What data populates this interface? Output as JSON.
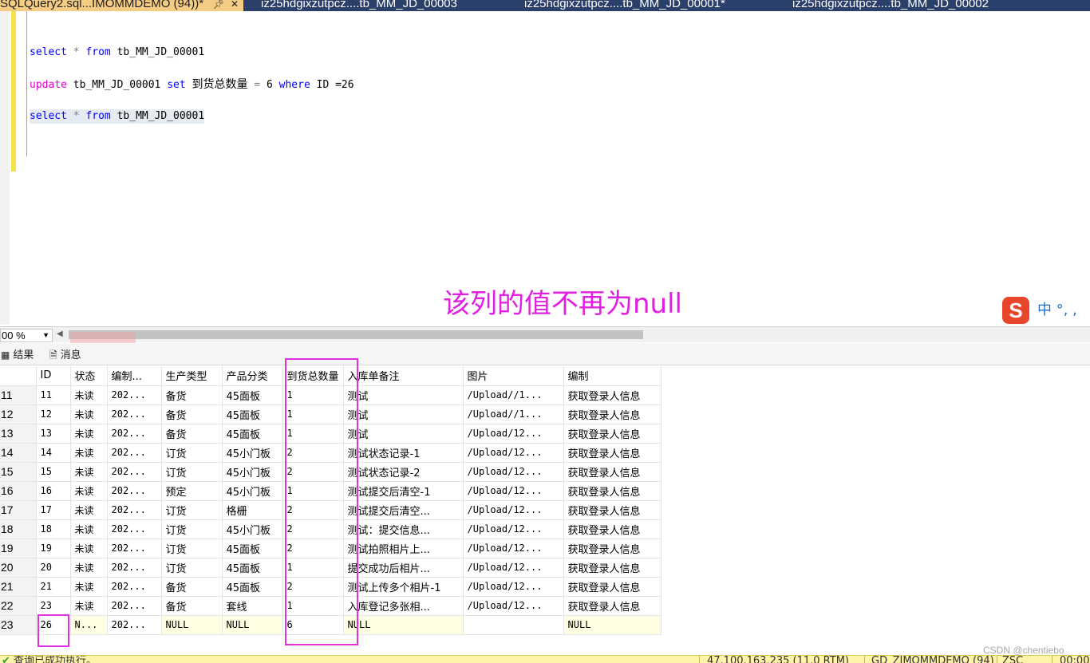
{
  "tabs": [
    {
      "label": "SQLQuery2.sql...IMOMMDEMO (94))*",
      "active": true
    },
    {
      "label": "iz25hdgixzutpcz....tb_MM_JD_00003",
      "active": false
    },
    {
      "label": "iz25hdgixzutpcz....tb_MM_JD_00001*",
      "active": false
    },
    {
      "label": "iz25hdgixzutpcz....tb_MM_JD_00002",
      "active": false
    }
  ],
  "editor": {
    "line1": {
      "kw_select": "select",
      "star": "*",
      "kw_from": "from",
      "table": "tb_MM_JD_00001"
    },
    "line2": {
      "kw_update": "update",
      "table": "tb_MM_JD_00001",
      "kw_set": "set",
      "column": "到货总数量",
      "eq": "=",
      "value": "6",
      "kw_where": "where",
      "cond": "ID =26"
    },
    "line3": {
      "kw_select": "select",
      "star": "*",
      "kw_from": "from",
      "table": "tb_MM_JD_00001"
    }
  },
  "annotation": "该列的值不再为null",
  "ime": {
    "logo": "S",
    "text": "中 °, ,"
  },
  "zoom": {
    "value": "00 %"
  },
  "results_tabs": {
    "results": "结果",
    "messages": "消息"
  },
  "grid": {
    "columns": [
      "ID",
      "状态",
      "编制...",
      "生产类型",
      "产品分类",
      "到货总数量",
      "入库单备注",
      "图片",
      "编制"
    ],
    "rows": [
      {
        "n": "11",
        "c": [
          "11",
          "未读",
          "202...",
          "备货",
          "45面板",
          "1",
          "测试",
          "/Upload//1...",
          "获取登录人信息"
        ]
      },
      {
        "n": "12",
        "c": [
          "12",
          "未读",
          "202...",
          "备货",
          "45面板",
          "1",
          "测试",
          "/Upload//1...",
          "获取登录人信息"
        ]
      },
      {
        "n": "13",
        "c": [
          "13",
          "未读",
          "202...",
          "备货",
          "45面板",
          "1",
          "测试",
          "/Upload/12...",
          "获取登录人信息"
        ]
      },
      {
        "n": "14",
        "c": [
          "14",
          "未读",
          "202...",
          "订货",
          "45小门板",
          "2",
          "测试状态记录-1",
          "/Upload/12...",
          "获取登录人信息"
        ]
      },
      {
        "n": "15",
        "c": [
          "15",
          "未读",
          "202...",
          "订货",
          "45小门板",
          "2",
          "测试状态记录-2",
          "/Upload/12...",
          "获取登录人信息"
        ]
      },
      {
        "n": "16",
        "c": [
          "16",
          "未读",
          "202...",
          "预定",
          "45小门板",
          "1",
          "测试提交后清空-1",
          "/Upload/12...",
          "获取登录人信息"
        ]
      },
      {
        "n": "17",
        "c": [
          "17",
          "未读",
          "202...",
          "订货",
          "格栅",
          "2",
          "测试提交后清空...",
          "/Upload/12...",
          "获取登录人信息"
        ]
      },
      {
        "n": "18",
        "c": [
          "18",
          "未读",
          "202...",
          "订货",
          "45小门板",
          "2",
          "测试：提交信息...",
          "/Upload/12...",
          "获取登录人信息"
        ]
      },
      {
        "n": "19",
        "c": [
          "19",
          "未读",
          "202...",
          "订货",
          "45面板",
          "2",
          "测试拍照相片上...",
          "/Upload/12...",
          "获取登录人信息"
        ]
      },
      {
        "n": "20",
        "c": [
          "20",
          "未读",
          "202...",
          "订货",
          "45面板",
          "1",
          "提交成功后相片...",
          "/Upload/12...",
          "获取登录人信息"
        ]
      },
      {
        "n": "21",
        "c": [
          "21",
          "未读",
          "202...",
          "备货",
          "45面板",
          "2",
          "测试上传多个相片-1",
          "/Upload/12...",
          "获取登录人信息"
        ]
      },
      {
        "n": "22",
        "c": [
          "23",
          "未读",
          "202...",
          "备货",
          "套线",
          "1",
          "入库登记多张相...",
          "/Upload/12...",
          "获取登录人信息"
        ]
      },
      {
        "n": "23",
        "c": [
          "26",
          "N...",
          "202...",
          "NULL",
          "NULL",
          "6",
          "NULL",
          "",
          "NULL"
        ]
      }
    ]
  },
  "statusbar": {
    "message": "查询已成功执行。",
    "server": "47.100.163.235 (11.0 RTM)",
    "db": "GD_ZIMOMMDEMO (94)",
    "user": "ZSC",
    "time": "00:00"
  },
  "watermark": "CSDN @chentiebo",
  "colors": {
    "accent_pink": "#e030e0",
    "tab_bg": "#2b3f6b",
    "active_tab": "#f5cc84",
    "keyword_blue": "#0000ff",
    "keyword_magenta": "#e000d0",
    "status_bar": "#fff4a8"
  }
}
